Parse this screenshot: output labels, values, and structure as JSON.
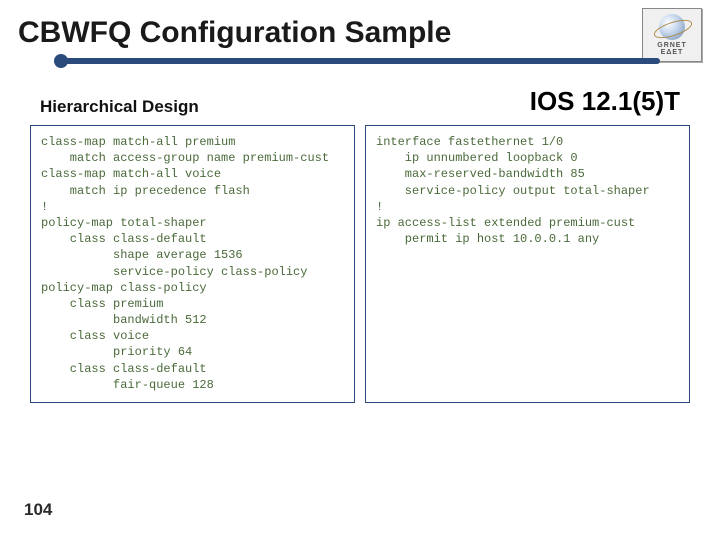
{
  "title": "CBWFQ Configuration Sample",
  "subheader_left": "Hierarchical Design",
  "subheader_right": "IOS 12.1(5)T",
  "logo": {
    "line1": "GRNET",
    "line2": "ΕΔΕΤ"
  },
  "code_left": "class-map match-all premium\n    match access-group name premium-cust\nclass-map match-all voice\n    match ip precedence flash\n!\npolicy-map total-shaper\n    class class-default\n          shape average 1536\n          service-policy class-policy\npolicy-map class-policy\n    class premium\n          bandwidth 512\n    class voice\n          priority 64\n    class class-default\n          fair-queue 128",
  "code_right": "interface fastethernet 1/0\n    ip unnumbered loopback 0\n    max-reserved-bandwidth 85\n    service-policy output total-shaper\n!\nip access-list extended premium-cust\n    permit ip host 10.0.0.1 any",
  "page_number": "104"
}
